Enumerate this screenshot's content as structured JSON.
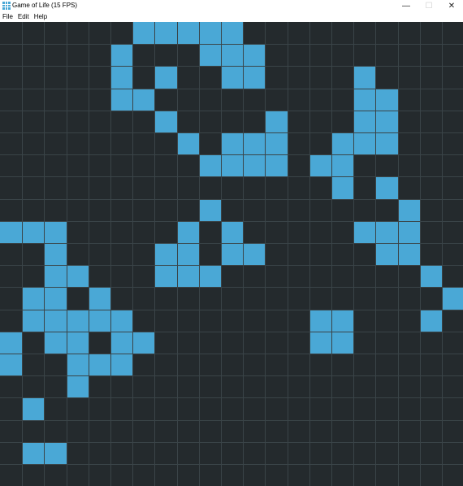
{
  "window": {
    "title": "Game of Life (15 FPS)",
    "icon": "grid-icon",
    "controls": {
      "minimize": "—",
      "maximize": "☐",
      "close": "✕"
    }
  },
  "menu": {
    "items": [
      "File",
      "Edit",
      "Help"
    ]
  },
  "colors": {
    "live_cell": "#4aa8d6",
    "dead_cell": "#242a2d",
    "grid_line": "#3a4448"
  },
  "board": {
    "live_cells": [
      [
        0,
        6
      ],
      [
        0,
        7
      ],
      [
        0,
        8
      ],
      [
        0,
        9
      ],
      [
        0,
        10
      ],
      [
        1,
        5
      ],
      [
        1,
        9
      ],
      [
        1,
        10
      ],
      [
        1,
        11
      ],
      [
        2,
        5
      ],
      [
        2,
        7
      ],
      [
        2,
        10
      ],
      [
        2,
        11
      ],
      [
        2,
        16
      ],
      [
        3,
        5
      ],
      [
        3,
        6
      ],
      [
        3,
        16
      ],
      [
        3,
        17
      ],
      [
        4,
        7
      ],
      [
        4,
        12
      ],
      [
        4,
        16
      ],
      [
        4,
        17
      ],
      [
        5,
        8
      ],
      [
        5,
        10
      ],
      [
        5,
        11
      ],
      [
        5,
        12
      ],
      [
        5,
        15
      ],
      [
        5,
        16
      ],
      [
        5,
        17
      ],
      [
        6,
        9
      ],
      [
        6,
        10
      ],
      [
        6,
        11
      ],
      [
        6,
        12
      ],
      [
        6,
        14
      ],
      [
        6,
        15
      ],
      [
        7,
        15
      ],
      [
        7,
        17
      ],
      [
        8,
        9
      ],
      [
        8,
        18
      ],
      [
        9,
        0
      ],
      [
        9,
        1
      ],
      [
        9,
        2
      ],
      [
        9,
        8
      ],
      [
        9,
        10
      ],
      [
        9,
        16
      ],
      [
        9,
        17
      ],
      [
        9,
        18
      ],
      [
        10,
        2
      ],
      [
        10,
        7
      ],
      [
        10,
        8
      ],
      [
        10,
        10
      ],
      [
        10,
        11
      ],
      [
        10,
        17
      ],
      [
        10,
        18
      ],
      [
        11,
        2
      ],
      [
        11,
        3
      ],
      [
        11,
        7
      ],
      [
        11,
        8
      ],
      [
        11,
        9
      ],
      [
        11,
        19
      ],
      [
        12,
        1
      ],
      [
        12,
        2
      ],
      [
        12,
        4
      ],
      [
        12,
        20
      ],
      [
        13,
        1
      ],
      [
        13,
        2
      ],
      [
        13,
        3
      ],
      [
        13,
        4
      ],
      [
        13,
        5
      ],
      [
        13,
        14
      ],
      [
        13,
        15
      ],
      [
        13,
        19
      ],
      [
        14,
        0
      ],
      [
        14,
        2
      ],
      [
        14,
        3
      ],
      [
        14,
        5
      ],
      [
        14,
        6
      ],
      [
        14,
        14
      ],
      [
        14,
        15
      ],
      [
        15,
        0
      ],
      [
        15,
        3
      ],
      [
        15,
        4
      ],
      [
        15,
        5
      ],
      [
        16,
        3
      ],
      [
        17,
        1
      ],
      [
        19,
        1
      ],
      [
        19,
        2
      ]
    ]
  }
}
